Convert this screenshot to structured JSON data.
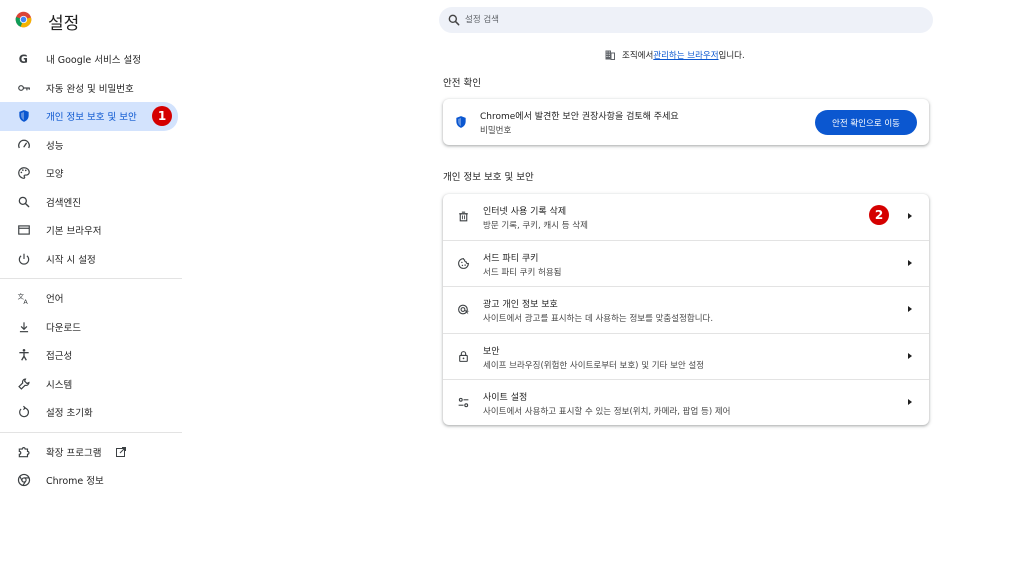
{
  "header": {
    "title": "설정",
    "search_placeholder": "설정 검색"
  },
  "sidebar": {
    "items": [
      {
        "label": "내 Google 서비스 설정",
        "icon": "google-g-icon"
      },
      {
        "label": "자동 완성 및 비밀번호",
        "icon": "key-icon"
      },
      {
        "label": "개인 정보 보호 및 보안",
        "icon": "shield-icon",
        "active": true
      },
      {
        "label": "성능",
        "icon": "gauge-icon"
      },
      {
        "label": "모양",
        "icon": "palette-icon"
      },
      {
        "label": "검색엔진",
        "icon": "search-icon"
      },
      {
        "label": "기본 브라우저",
        "icon": "browser-window-icon"
      },
      {
        "label": "시작 시 설정",
        "icon": "power-icon"
      },
      {
        "label": "언어",
        "icon": "translate-icon"
      },
      {
        "label": "다운로드",
        "icon": "download-icon"
      },
      {
        "label": "접근성",
        "icon": "accessibility-icon"
      },
      {
        "label": "시스템",
        "icon": "wrench-icon"
      },
      {
        "label": "설정 초기화",
        "icon": "reset-icon"
      },
      {
        "label": "확장 프로그램",
        "icon": "puzzle-icon"
      },
      {
        "label": "Chrome 정보",
        "icon": "chrome-icon"
      }
    ]
  },
  "annotations": {
    "badge1": "1",
    "badge2": "2"
  },
  "managed": {
    "prefix": "조직에서 ",
    "link": "관리하는 브라우저",
    "suffix": "입니다."
  },
  "safety_check": {
    "section_title": "안전 확인",
    "title": "Chrome에서 발견한 보안 권장사항을 검토해 주세요",
    "subtitle": "비밀번호",
    "button": "안전 확인으로 이동"
  },
  "privacy": {
    "section_title": "개인 정보 보호 및 보안",
    "rows": [
      {
        "title": "인터넷 사용 기록 삭제",
        "subtitle": "방문 기록, 쿠키, 캐시 등 삭제",
        "icon": "trash-icon"
      },
      {
        "title": "서드 파티 쿠키",
        "subtitle": "서드 파티 쿠키 허용됨",
        "icon": "cookie-icon"
      },
      {
        "title": "광고 개인 정보 보호",
        "subtitle": "사이트에서 광고를 표시하는 데 사용하는 정보를 맞춤설정합니다.",
        "icon": "ad-privacy-icon"
      },
      {
        "title": "보안",
        "subtitle": "세이프 브라우징(위험한 사이트로부터 보호) 및 기타 보안 설정",
        "icon": "lock-icon"
      },
      {
        "title": "사이트 설정",
        "subtitle": "사이트에서 사용하고 표시할 수 있는 정보(위치, 카메라, 팝업 등) 제어",
        "icon": "tune-icon"
      }
    ]
  },
  "colors": {
    "accent": "#0b57d0",
    "active_bg": "#d3e3fd",
    "badge": "#d50000"
  }
}
